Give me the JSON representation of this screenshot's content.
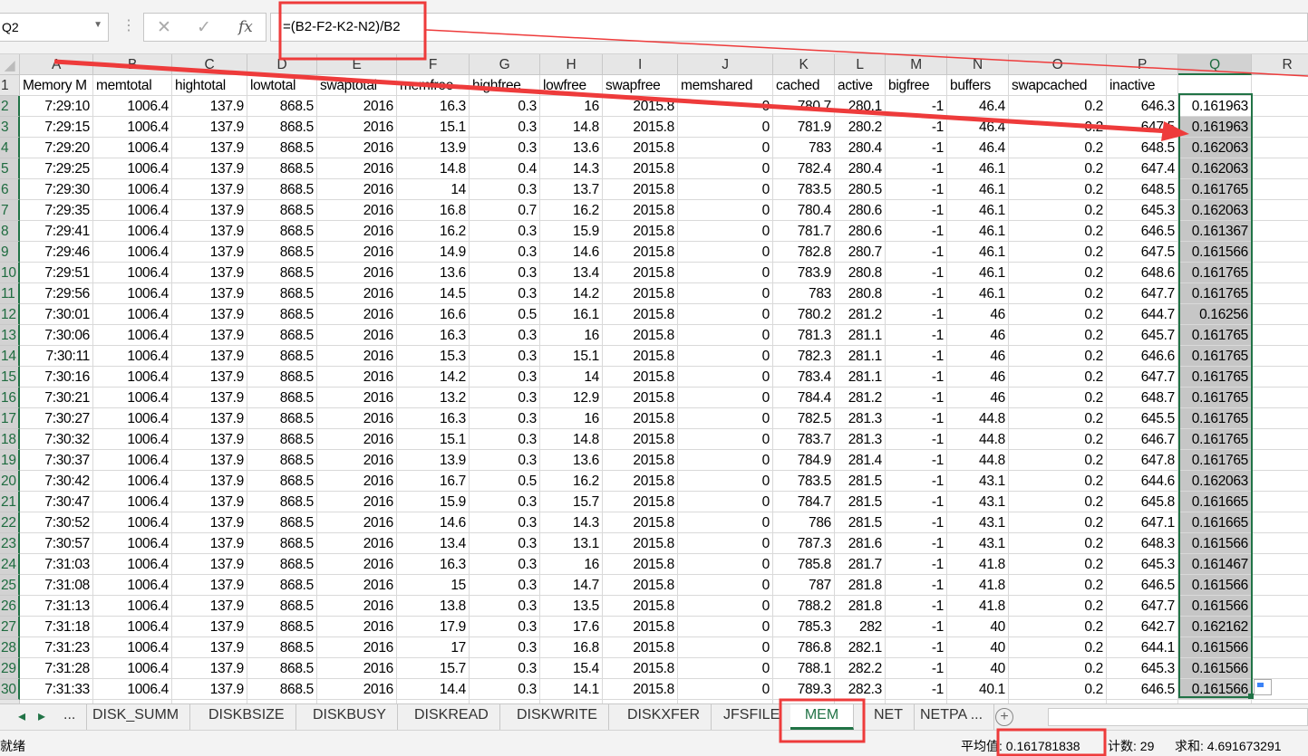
{
  "name_box": "Q2",
  "formula": "=(B2-F2-K2-N2)/B2",
  "formula_buttons": {
    "cancel": "✕",
    "enter": "✓",
    "fx": "fx"
  },
  "columns": [
    "A",
    "B",
    "C",
    "D",
    "E",
    "F",
    "G",
    "H",
    "I",
    "J",
    "K",
    "L",
    "M",
    "N",
    "O",
    "P",
    "Q",
    "R"
  ],
  "selected_column": "Q",
  "headers": [
    "Memory M",
    "memtotal",
    "hightotal",
    "lowtotal",
    "swaptotal",
    "memfree",
    "highfree",
    "lowfree",
    "swapfree",
    "memshared",
    "cached",
    "active",
    "bigfree",
    "buffers",
    "swapcached",
    "inactive",
    ""
  ],
  "rows": [
    [
      "7:29:10",
      "1006.4",
      "137.9",
      "868.5",
      "2016",
      "16.3",
      "0.3",
      "16",
      "2015.8",
      "0",
      "780.7",
      "280.1",
      "-1",
      "46.4",
      "0.2",
      "646.3",
      "0.161963"
    ],
    [
      "7:29:15",
      "1006.4",
      "137.9",
      "868.5",
      "2016",
      "15.1",
      "0.3",
      "14.8",
      "2015.8",
      "0",
      "781.9",
      "280.2",
      "-1",
      "46.4",
      "0.2",
      "647.5",
      "0.161963"
    ],
    [
      "7:29:20",
      "1006.4",
      "137.9",
      "868.5",
      "2016",
      "13.9",
      "0.3",
      "13.6",
      "2015.8",
      "0",
      "783",
      "280.4",
      "-1",
      "46.4",
      "0.2",
      "648.5",
      "0.162063"
    ],
    [
      "7:29:25",
      "1006.4",
      "137.9",
      "868.5",
      "2016",
      "14.8",
      "0.4",
      "14.3",
      "2015.8",
      "0",
      "782.4",
      "280.4",
      "-1",
      "46.1",
      "0.2",
      "647.4",
      "0.162063"
    ],
    [
      "7:29:30",
      "1006.4",
      "137.9",
      "868.5",
      "2016",
      "14",
      "0.3",
      "13.7",
      "2015.8",
      "0",
      "783.5",
      "280.5",
      "-1",
      "46.1",
      "0.2",
      "648.5",
      "0.161765"
    ],
    [
      "7:29:35",
      "1006.4",
      "137.9",
      "868.5",
      "2016",
      "16.8",
      "0.7",
      "16.2",
      "2015.8",
      "0",
      "780.4",
      "280.6",
      "-1",
      "46.1",
      "0.2",
      "645.3",
      "0.162063"
    ],
    [
      "7:29:41",
      "1006.4",
      "137.9",
      "868.5",
      "2016",
      "16.2",
      "0.3",
      "15.9",
      "2015.8",
      "0",
      "781.7",
      "280.6",
      "-1",
      "46.1",
      "0.2",
      "646.5",
      "0.161367"
    ],
    [
      "7:29:46",
      "1006.4",
      "137.9",
      "868.5",
      "2016",
      "14.9",
      "0.3",
      "14.6",
      "2015.8",
      "0",
      "782.8",
      "280.7",
      "-1",
      "46.1",
      "0.2",
      "647.5",
      "0.161566"
    ],
    [
      "7:29:51",
      "1006.4",
      "137.9",
      "868.5",
      "2016",
      "13.6",
      "0.3",
      "13.4",
      "2015.8",
      "0",
      "783.9",
      "280.8",
      "-1",
      "46.1",
      "0.2",
      "648.6",
      "0.161765"
    ],
    [
      "7:29:56",
      "1006.4",
      "137.9",
      "868.5",
      "2016",
      "14.5",
      "0.3",
      "14.2",
      "2015.8",
      "0",
      "783",
      "280.8",
      "-1",
      "46.1",
      "0.2",
      "647.7",
      "0.161765"
    ],
    [
      "7:30:01",
      "1006.4",
      "137.9",
      "868.5",
      "2016",
      "16.6",
      "0.5",
      "16.1",
      "2015.8",
      "0",
      "780.2",
      "281.2",
      "-1",
      "46",
      "0.2",
      "644.7",
      "0.16256"
    ],
    [
      "7:30:06",
      "1006.4",
      "137.9",
      "868.5",
      "2016",
      "16.3",
      "0.3",
      "16",
      "2015.8",
      "0",
      "781.3",
      "281.1",
      "-1",
      "46",
      "0.2",
      "645.7",
      "0.161765"
    ],
    [
      "7:30:11",
      "1006.4",
      "137.9",
      "868.5",
      "2016",
      "15.3",
      "0.3",
      "15.1",
      "2015.8",
      "0",
      "782.3",
      "281.1",
      "-1",
      "46",
      "0.2",
      "646.6",
      "0.161765"
    ],
    [
      "7:30:16",
      "1006.4",
      "137.9",
      "868.5",
      "2016",
      "14.2",
      "0.3",
      "14",
      "2015.8",
      "0",
      "783.4",
      "281.1",
      "-1",
      "46",
      "0.2",
      "647.7",
      "0.161765"
    ],
    [
      "7:30:21",
      "1006.4",
      "137.9",
      "868.5",
      "2016",
      "13.2",
      "0.3",
      "12.9",
      "2015.8",
      "0",
      "784.4",
      "281.2",
      "-1",
      "46",
      "0.2",
      "648.7",
      "0.161765"
    ],
    [
      "7:30:27",
      "1006.4",
      "137.9",
      "868.5",
      "2016",
      "16.3",
      "0.3",
      "16",
      "2015.8",
      "0",
      "782.5",
      "281.3",
      "-1",
      "44.8",
      "0.2",
      "645.5",
      "0.161765"
    ],
    [
      "7:30:32",
      "1006.4",
      "137.9",
      "868.5",
      "2016",
      "15.1",
      "0.3",
      "14.8",
      "2015.8",
      "0",
      "783.7",
      "281.3",
      "-1",
      "44.8",
      "0.2",
      "646.7",
      "0.161765"
    ],
    [
      "7:30:37",
      "1006.4",
      "137.9",
      "868.5",
      "2016",
      "13.9",
      "0.3",
      "13.6",
      "2015.8",
      "0",
      "784.9",
      "281.4",
      "-1",
      "44.8",
      "0.2",
      "647.8",
      "0.161765"
    ],
    [
      "7:30:42",
      "1006.4",
      "137.9",
      "868.5",
      "2016",
      "16.7",
      "0.5",
      "16.2",
      "2015.8",
      "0",
      "783.5",
      "281.5",
      "-1",
      "43.1",
      "0.2",
      "644.6",
      "0.162063"
    ],
    [
      "7:30:47",
      "1006.4",
      "137.9",
      "868.5",
      "2016",
      "15.9",
      "0.3",
      "15.7",
      "2015.8",
      "0",
      "784.7",
      "281.5",
      "-1",
      "43.1",
      "0.2",
      "645.8",
      "0.161665"
    ],
    [
      "7:30:52",
      "1006.4",
      "137.9",
      "868.5",
      "2016",
      "14.6",
      "0.3",
      "14.3",
      "2015.8",
      "0",
      "786",
      "281.5",
      "-1",
      "43.1",
      "0.2",
      "647.1",
      "0.161665"
    ],
    [
      "7:30:57",
      "1006.4",
      "137.9",
      "868.5",
      "2016",
      "13.4",
      "0.3",
      "13.1",
      "2015.8",
      "0",
      "787.3",
      "281.6",
      "-1",
      "43.1",
      "0.2",
      "648.3",
      "0.161566"
    ],
    [
      "7:31:03",
      "1006.4",
      "137.9",
      "868.5",
      "2016",
      "16.3",
      "0.3",
      "16",
      "2015.8",
      "0",
      "785.8",
      "281.7",
      "-1",
      "41.8",
      "0.2",
      "645.3",
      "0.161467"
    ],
    [
      "7:31:08",
      "1006.4",
      "137.9",
      "868.5",
      "2016",
      "15",
      "0.3",
      "14.7",
      "2015.8",
      "0",
      "787",
      "281.8",
      "-1",
      "41.8",
      "0.2",
      "646.5",
      "0.161566"
    ],
    [
      "7:31:13",
      "1006.4",
      "137.9",
      "868.5",
      "2016",
      "13.8",
      "0.3",
      "13.5",
      "2015.8",
      "0",
      "788.2",
      "281.8",
      "-1",
      "41.8",
      "0.2",
      "647.7",
      "0.161566"
    ],
    [
      "7:31:18",
      "1006.4",
      "137.9",
      "868.5",
      "2016",
      "17.9",
      "0.3",
      "17.6",
      "2015.8",
      "0",
      "785.3",
      "282",
      "-1",
      "40",
      "0.2",
      "642.7",
      "0.162162"
    ],
    [
      "7:31:23",
      "1006.4",
      "137.9",
      "868.5",
      "2016",
      "17",
      "0.3",
      "16.8",
      "2015.8",
      "0",
      "786.8",
      "282.1",
      "-1",
      "40",
      "0.2",
      "644.1",
      "0.161566"
    ],
    [
      "7:31:28",
      "1006.4",
      "137.9",
      "868.5",
      "2016",
      "15.7",
      "0.3",
      "15.4",
      "2015.8",
      "0",
      "788.1",
      "282.2",
      "-1",
      "40",
      "0.2",
      "645.3",
      "0.161566"
    ],
    [
      "7:31:33",
      "1006.4",
      "137.9",
      "868.5",
      "2016",
      "14.4",
      "0.3",
      "14.1",
      "2015.8",
      "0",
      "789.3",
      "282.3",
      "-1",
      "40.1",
      "0.2",
      "646.5",
      "0.161566"
    ]
  ],
  "sheet_tabs": {
    "nav_more": "...",
    "items": [
      "DISK_SUMM",
      "DISKBSIZE",
      "DISKBUSY",
      "DISKREAD",
      "DISKWRITE",
      "DISKXFER",
      "JFSFILE",
      "MEM",
      "NET",
      "NETPA ..."
    ],
    "active": "MEM",
    "add": "+"
  },
  "status": {
    "ready": "就绪",
    "average": "平均值: 0.161781838",
    "count": "计数: 29",
    "sum": "求和: 4.691673291"
  },
  "colors": {
    "accent": "#217346",
    "annotation": "#ee3b3b"
  }
}
